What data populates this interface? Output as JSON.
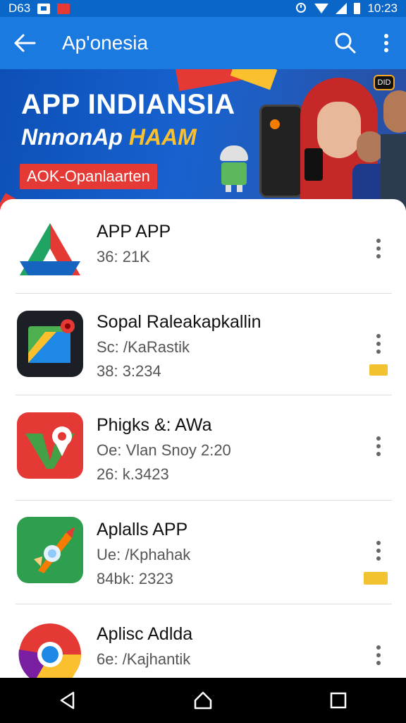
{
  "status_bar": {
    "left_text": "D63",
    "time": "10:23"
  },
  "app_bar": {
    "title": "Ap'onesia"
  },
  "banner": {
    "title": "APP INDIANSIA",
    "subtitle_main": "NnnonAp ",
    "subtitle_highlight": "HAAM",
    "cta": "AOK-Opanlaarten",
    "badge": "DID"
  },
  "apps": [
    {
      "name": "APP APP",
      "meta": "36: 21K",
      "meta2": "",
      "flag": false
    },
    {
      "name": "Sopal Raleakapkallin",
      "meta": "Sc: /KaRastik",
      "meta2": "38: 3:234",
      "flag": true
    },
    {
      "name": "Phigks &: AWa",
      "meta": "Oe: Vlan Snoy 2:20",
      "meta2": "26: k.3423",
      "flag": false
    },
    {
      "name": "Aplalls APP",
      "meta": "Ue: /Kphahak",
      "meta2": "84bk: 2323",
      "flag": true
    },
    {
      "name": "Aplisc Adlda",
      "meta": "6e: /Kajhantik",
      "meta2": "",
      "flag": false
    }
  ],
  "colors": {
    "app_bar": "#1a7ae0",
    "status_bar": "#0b67c7",
    "accent_red": "#e53935",
    "accent_yellow": "#f2c230"
  }
}
